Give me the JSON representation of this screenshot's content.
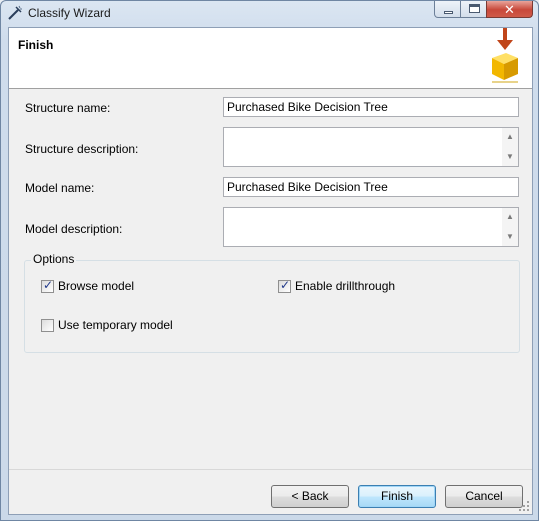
{
  "window": {
    "title": "Classify Wizard"
  },
  "header": {
    "title": "Finish"
  },
  "form": {
    "structure_name_label": "Structure name:",
    "structure_name_value": "Purchased Bike Decision Tree",
    "structure_description_label": "Structure description:",
    "structure_description_value": "",
    "model_name_label": "Model name:",
    "model_name_value": "Purchased Bike Decision Tree",
    "model_description_label": "Model description:",
    "model_description_value": ""
  },
  "options": {
    "legend": "Options",
    "browse_model": {
      "label": "Browse model",
      "checked": true
    },
    "enable_drillthrough": {
      "label": "Enable drillthrough",
      "checked": true
    },
    "use_temporary_model": {
      "label": "Use temporary model",
      "checked": false
    }
  },
  "buttons": {
    "back": "< Back",
    "finish": "Finish",
    "cancel": "Cancel"
  },
  "colors": {
    "accent_arrow": "#c0451a",
    "cube": "#f2b700",
    "close_button": "#c8483a"
  }
}
